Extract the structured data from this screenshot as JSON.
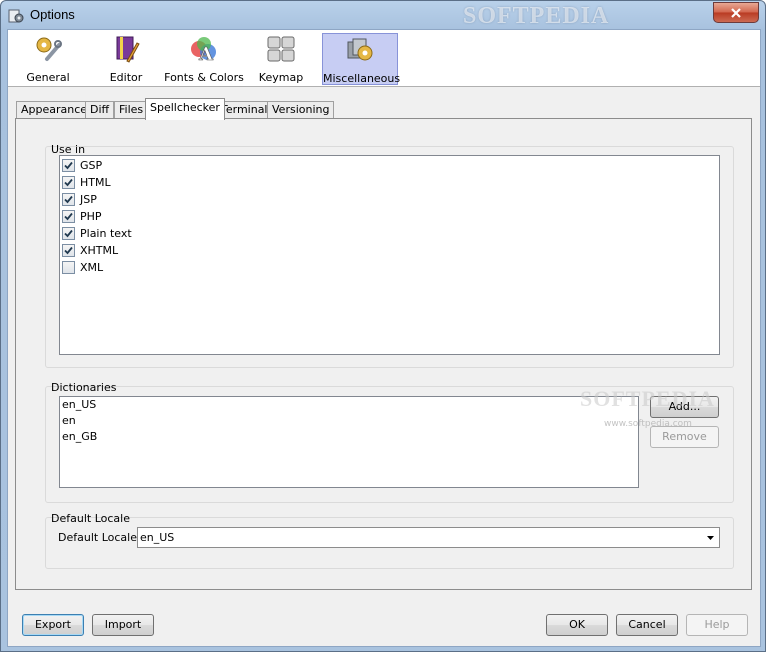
{
  "window": {
    "title": "Options",
    "watermark": "SOFTPEDIA"
  },
  "categories": [
    {
      "label": "General",
      "icon": "wrench-gear-icon",
      "selected": false
    },
    {
      "label": "Editor",
      "icon": "book-pencil-icon",
      "selected": false
    },
    {
      "label": "Fonts & Colors",
      "icon": "font-palette-icon",
      "selected": false
    },
    {
      "label": "Keymap",
      "icon": "keyboard-keys-icon",
      "selected": false
    },
    {
      "label": "Miscellaneous",
      "icon": "misc-gear-icon",
      "selected": true
    }
  ],
  "tabs": [
    {
      "label": "Appearance",
      "active": false
    },
    {
      "label": "Diff",
      "active": false
    },
    {
      "label": "Files",
      "active": false
    },
    {
      "label": "Spellchecker",
      "active": true
    },
    {
      "label": "Terminal",
      "active": false
    },
    {
      "label": "Versioning",
      "active": false
    }
  ],
  "use_in": {
    "label": "Use in",
    "items": [
      {
        "label": "GSP",
        "checked": true
      },
      {
        "label": "HTML",
        "checked": true
      },
      {
        "label": "JSP",
        "checked": true
      },
      {
        "label": "PHP",
        "checked": true
      },
      {
        "label": "Plain text",
        "checked": true
      },
      {
        "label": "XHTML",
        "checked": true
      },
      {
        "label": "XML",
        "checked": false
      }
    ]
  },
  "dictionaries": {
    "label": "Dictionaries",
    "items": [
      "en_US",
      "en",
      "en_GB"
    ],
    "add_label": "Add...",
    "remove_label": "Remove"
  },
  "locale": {
    "section_label": "Default Locale",
    "field_label": "Default Locale:",
    "value": "en_US"
  },
  "footer": {
    "export_label": "Export",
    "import_label": "Import",
    "ok_label": "OK",
    "cancel_label": "Cancel",
    "help_label": "Help"
  },
  "softpedia_watermark": {
    "text": "SOFTPEDIA",
    "url": "www.softpedia.com"
  }
}
